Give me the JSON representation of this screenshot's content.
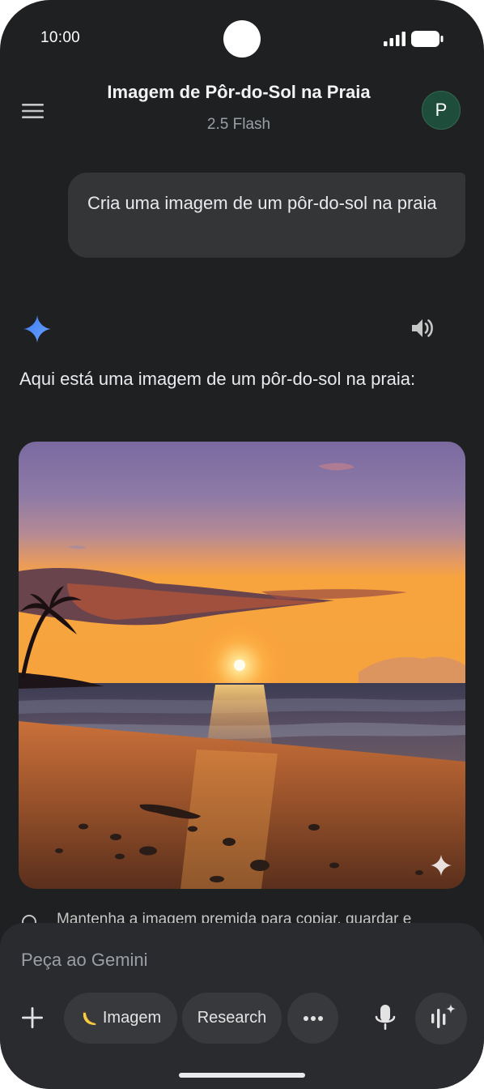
{
  "status_bar": {
    "time": "10:00",
    "icons": [
      "signal-icon",
      "battery-icon"
    ]
  },
  "header": {
    "menu_icon": "menu-icon",
    "title": "Imagem de Pôr-do-Sol na Praia",
    "model": "2.5 Flash",
    "avatar_letter": "P"
  },
  "conversation": {
    "user_message": "Cria uma imagem de um pôr-do-sol na praia",
    "response_icon": "gemini-spark-icon",
    "listen_icon": "speaker-icon",
    "response_text": "Aqui está uma imagem de um pôr-do-sol na praia:",
    "image": {
      "subject": "sunset-beach-image",
      "overlay_icon": "ai-spark-icon"
    },
    "hint_text": "Mantenha a imagem premida para copiar, guardar e"
  },
  "composer": {
    "placeholder": "Peça ao Gemini",
    "add_icon": "plus-icon",
    "chips": [
      {
        "label": "Imagem",
        "icon": "banana-icon"
      },
      {
        "label": "Research"
      },
      {
        "label": "•••",
        "icon": "more-icon"
      }
    ],
    "mic_icon": "mic-icon",
    "live_icon": "live-icon"
  },
  "colors": {
    "background": "#1f2022",
    "bubble": "#333537",
    "composer": "#2a2b2e",
    "chip": "#38393c",
    "avatar": "#1f4d3c",
    "accent_blue": "#4c8df6"
  }
}
